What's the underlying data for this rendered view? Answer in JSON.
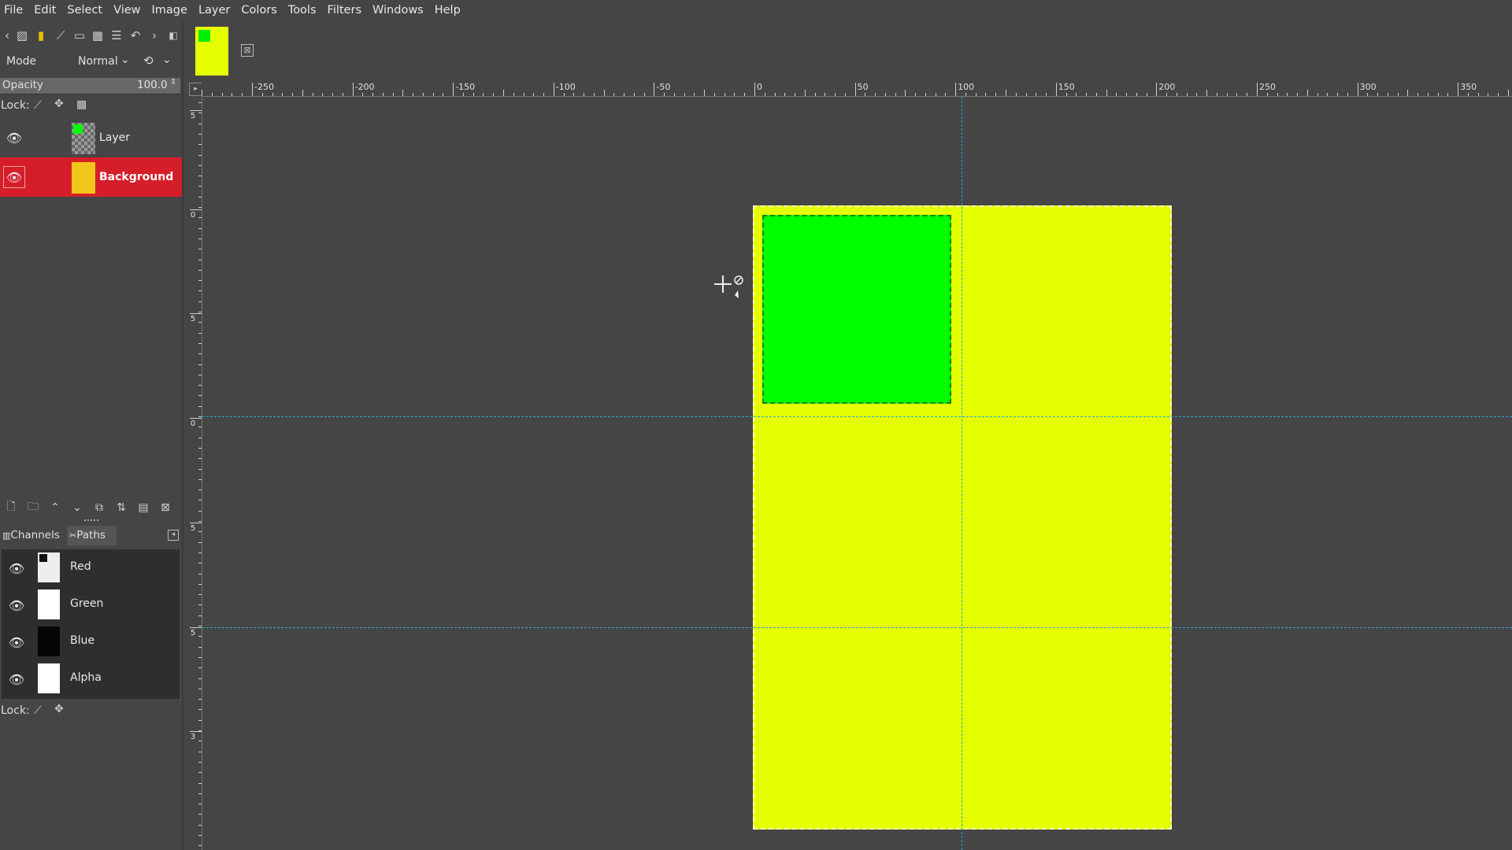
{
  "menubar": [
    "File",
    "Edit",
    "Select",
    "View",
    "Image",
    "Layer",
    "Colors",
    "Tools",
    "Filters",
    "Windows",
    "Help"
  ],
  "image_tab": {
    "close_symbol": "⊠"
  },
  "layers_panel": {
    "mode_label": "Mode",
    "mode_value": "Normal",
    "opacity_label": "Opacity",
    "opacity_value": "100.0",
    "opacity_fraction": 1.0,
    "lock_label": "Lock:",
    "layers": [
      {
        "name": "Layer",
        "visible": true,
        "selected": false
      },
      {
        "name": "Background",
        "visible": true,
        "selected": true
      }
    ]
  },
  "channels_panel": {
    "tabs": [
      "Channels",
      "Paths"
    ],
    "channels": [
      {
        "name": "Red"
      },
      {
        "name": "Green"
      },
      {
        "name": "Blue"
      },
      {
        "name": "Alpha"
      }
    ],
    "lock_label": "Lock:"
  },
  "ruler": {
    "h_labels": [
      "-250",
      "-200",
      "-150",
      "-100",
      "-50",
      "0",
      "50",
      "100",
      "150",
      "200",
      "250",
      "300",
      "350"
    ],
    "v_labels": [
      "5",
      "0",
      "5",
      "0",
      "5",
      "5",
      "3"
    ]
  },
  "colors": {
    "background_layer": "#e5ff00",
    "top_layer": "#00ff00",
    "selection_highlight": "#d51e2a",
    "guide": "#2aa6d6"
  }
}
